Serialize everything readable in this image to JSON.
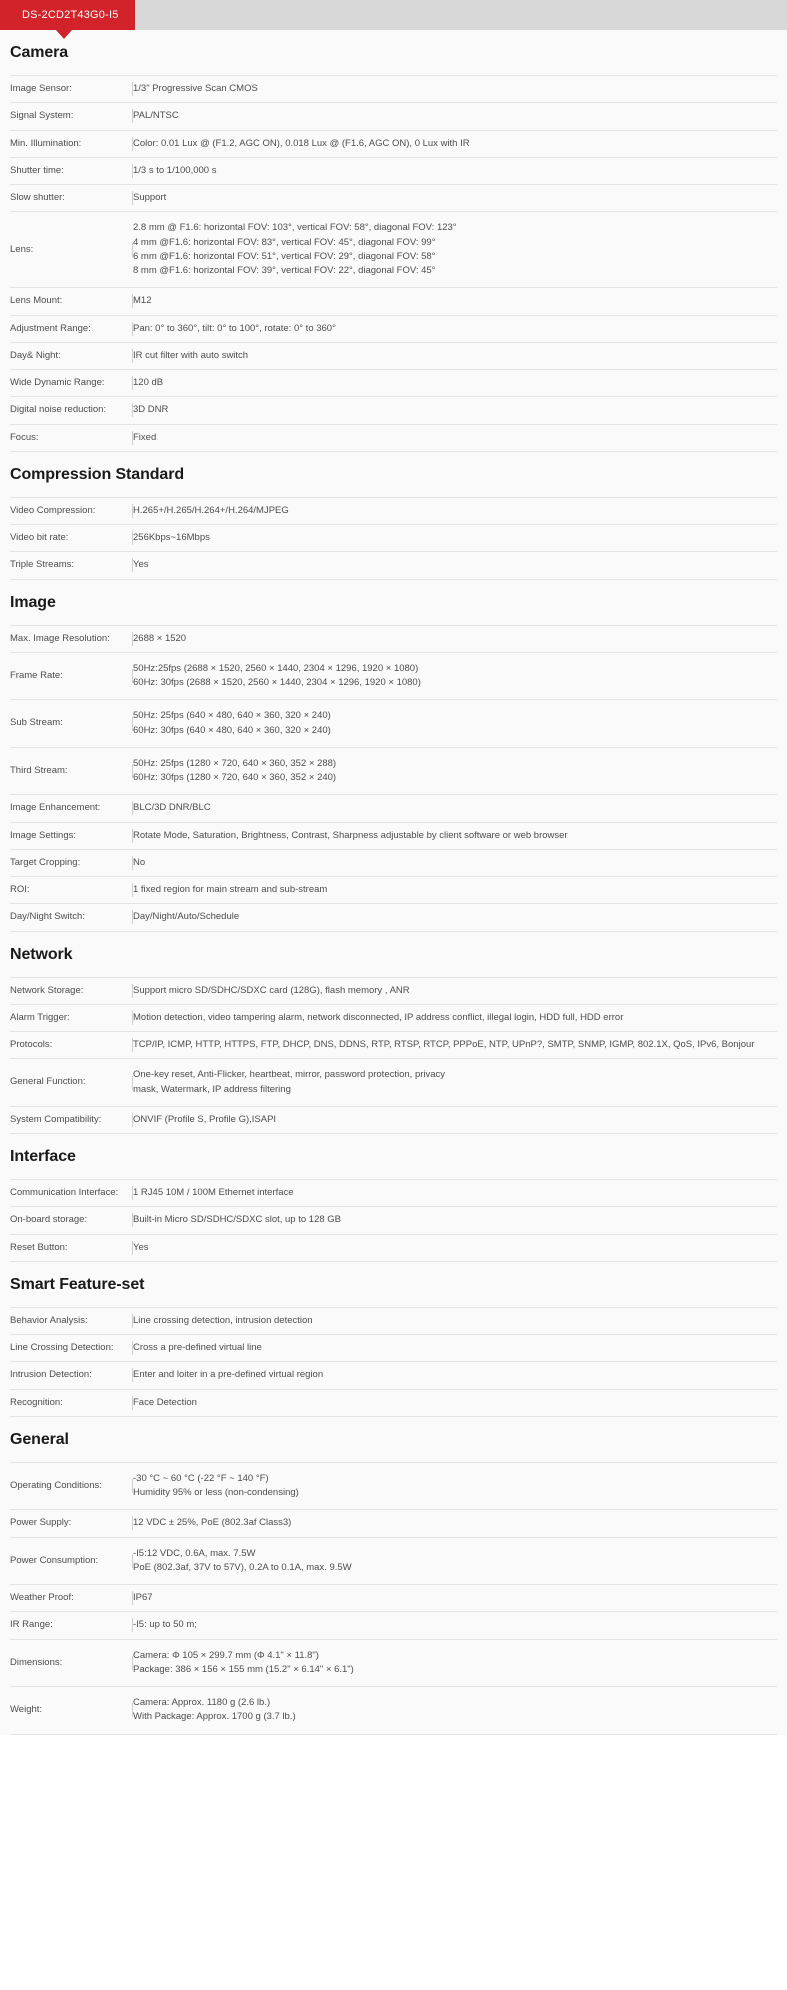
{
  "header": {
    "tab_label": "DS-2CD2T43G0-I5",
    "accent_color": "#d2232a",
    "bar_color": "#d8d8d8"
  },
  "sections": [
    {
      "title": "Camera",
      "rows": [
        {
          "key": "Image Sensor:",
          "value": "1/3\" Progressive Scan CMOS"
        },
        {
          "key": "Signal System:",
          "value": "PAL/NTSC"
        },
        {
          "key": "Min. Illumination:",
          "value": "Color: 0.01 Lux @ (F1.2, AGC ON), 0.018 Lux @ (F1.6, AGC ON), 0 Lux with IR"
        },
        {
          "key": "Shutter time:",
          "value": "1/3 s to 1/100,000 s"
        },
        {
          "key": "Slow shutter:",
          "value": "Support"
        },
        {
          "key": "Lens:",
          "value": "2.8 mm @ F1.6: horizontal FOV: 103°, vertical FOV: 58°, diagonal FOV: 123°\n4 mm @F1.6: horizontal FOV: 83°, vertical FOV: 45°, diagonal FOV: 99°\n6 mm @F1.6: horizontal FOV: 51°, vertical FOV: 29°, diagonal FOV: 58°\n8 mm @F1.6: horizontal FOV: 39°, vertical FOV: 22°, diagonal FOV: 45°"
        },
        {
          "key": "Lens Mount:",
          "value": "M12"
        },
        {
          "key": "Adjustment Range:",
          "value": "Pan: 0° to 360°, tilt: 0° to 100°, rotate: 0° to 360°"
        },
        {
          "key": "Day& Night:",
          "value": "IR cut filter with auto switch"
        },
        {
          "key": "Wide Dynamic Range:",
          "value": "120 dB"
        },
        {
          "key": "Digital noise reduction:",
          "value": "3D DNR"
        },
        {
          "key": "Focus:",
          "value": "Fixed"
        }
      ]
    },
    {
      "title": "Compression Standard",
      "rows": [
        {
          "key": "Video Compression:",
          "value": "H.265+/H.265/H.264+/H.264/MJPEG"
        },
        {
          "key": "Video bit rate:",
          "value": "256Kbps~16Mbps"
        },
        {
          "key": "Triple Streams:",
          "value": "Yes"
        }
      ]
    },
    {
      "title": "Image",
      "rows": [
        {
          "key": "Max. Image Resolution:",
          "value": "2688 × 1520"
        },
        {
          "key": "Frame Rate:",
          "value": "50Hz:25fps (2688 × 1520, 2560 × 1440, 2304 × 1296, 1920 × 1080)\n60Hz: 30fps (2688 × 1520, 2560 × 1440, 2304 × 1296, 1920 × 1080)"
        },
        {
          "key": "Sub Stream:",
          "value": "50Hz: 25fps (640 × 480, 640 × 360, 320 × 240)\n60Hz: 30fps (640 × 480, 640 × 360, 320 × 240)"
        },
        {
          "key": "Third Stream:",
          "value": "50Hz: 25fps (1280 × 720, 640 × 360, 352 × 288)\n60Hz: 30fps (1280 × 720, 640 × 360, 352 × 240)"
        },
        {
          "key": "Image Enhancement:",
          "value": "BLC/3D DNR/BLC"
        },
        {
          "key": "Image Settings:",
          "value": "Rotate Mode, Saturation, Brightness, Contrast, Sharpness adjustable by client software or web browser"
        },
        {
          "key": "Target Cropping:",
          "value": "No"
        },
        {
          "key": "ROI:",
          "value": "1 fixed region for main stream and sub-stream"
        },
        {
          "key": "Day/Night Switch:",
          "value": "Day/Night/Auto/Schedule"
        }
      ]
    },
    {
      "title": "Network",
      "rows": [
        {
          "key": "Network Storage:",
          "value": "Support micro SD/SDHC/SDXC card (128G), flash memory , ANR"
        },
        {
          "key": "Alarm Trigger:",
          "value": "Motion detection, video tampering alarm, network disconnected, IP address conflict, illegal login, HDD full, HDD error"
        },
        {
          "key": "Protocols:",
          "value": "TCP/IP, ICMP, HTTP, HTTPS, FTP, DHCP, DNS, DDNS, RTP, RTSP, RTCP, PPPoE, NTP, UPnP?, SMTP, SNMP, IGMP, 802.1X, QoS, IPv6, Bonjour"
        },
        {
          "key": "General Function:",
          "value": "One-key reset, Anti-Flicker, heartbeat, mirror, password protection, privacy\nmask, Watermark, IP address filtering"
        },
        {
          "key": "System Compatibility:",
          "value": "ONVIF (Profile S, Profile G),ISAPI"
        }
      ]
    },
    {
      "title": "Interface",
      "rows": [
        {
          "key": "Communication Interface:",
          "value": "1 RJ45 10M / 100M Ethernet interface"
        },
        {
          "key": "On-board storage:",
          "value": "Built-in Micro SD/SDHC/SDXC slot, up to 128 GB"
        },
        {
          "key": "Reset Button:",
          "value": "Yes"
        }
      ]
    },
    {
      "title": "Smart Feature-set",
      "rows": [
        {
          "key": "Behavior Analysis:",
          "value": "Line crossing detection, intrusion detection"
        },
        {
          "key": "Line Crossing Detection:",
          "value": "Cross a pre-defined virtual line"
        },
        {
          "key": "Intrusion Detection:",
          "value": "Enter and loiter in a pre-defined virtual region"
        },
        {
          "key": "Recognition:",
          "value": "Face Detection"
        }
      ]
    },
    {
      "title": "General",
      "rows": [
        {
          "key": "Operating Conditions:",
          "value": "-30 °C ~ 60 °C (-22 °F ~ 140 °F)\nHumidity 95% or less (non-condensing)"
        },
        {
          "key": "Power Supply:",
          "value": "12 VDC ± 25%, PoE (802.3af Class3)"
        },
        {
          "key": "Power Consumption:",
          "value": "-I5:12 VDC, 0.6A, max. 7.5W\nPoE (802.3af, 37V to 57V), 0.2A to 0.1A, max. 9.5W"
        },
        {
          "key": "Weather Proof:",
          "value": "IP67"
        },
        {
          "key": "IR Range:",
          "value": "-I5: up to 50 m;"
        },
        {
          "key": "Dimensions:",
          "value": "Camera: Φ 105 × 299.7 mm (Φ 4.1\" × 11.8\")\nPackage: 386 × 156 × 155 mm (15.2\" × 6.14\" × 6.1\")"
        },
        {
          "key": "Weight:",
          "value": "Camera: Approx. 1180 g (2.6 lb.)\nWith Package: Approx. 1700 g (3.7 lb.)"
        }
      ]
    }
  ]
}
